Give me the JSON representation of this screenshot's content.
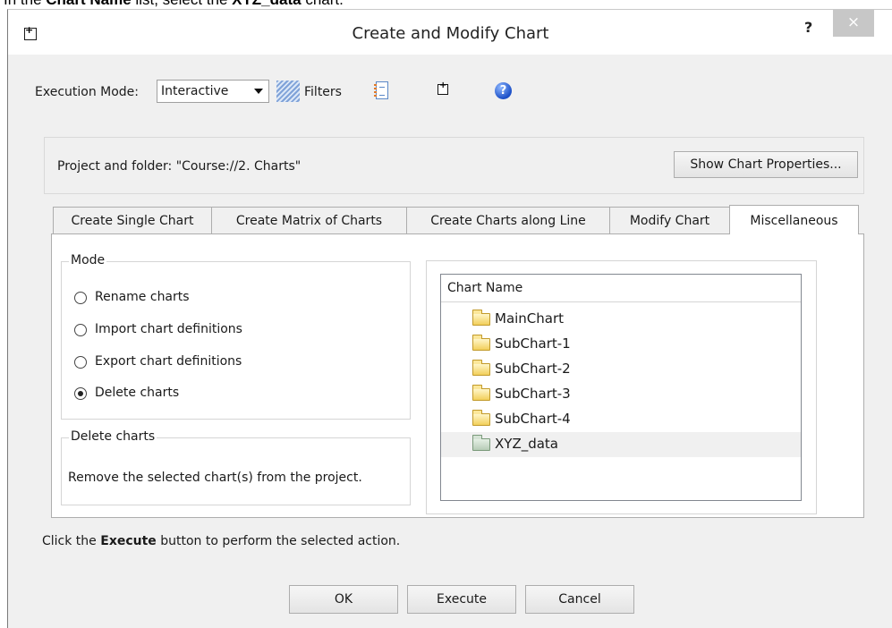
{
  "instruction": {
    "prefix": "In the ",
    "list_name": "Chart Name",
    "middle": " list, select the ",
    "item_name": "XYZ_data",
    "suffix": " chart."
  },
  "dialog": {
    "title": "Create and Modify Chart",
    "help_label": "?",
    "close_label": "×"
  },
  "toolbar": {
    "execution_mode_label": "Execution Mode:",
    "execution_mode_value": "Interactive",
    "filters_label": "Filters",
    "help_glyph": "?"
  },
  "project": {
    "label": "Project and folder: \"Course://2. Charts\"",
    "show_properties_button": "Show Chart Properties..."
  },
  "tabs": [
    {
      "label": "Create Single Chart",
      "active": false
    },
    {
      "label": "Create Matrix of Charts",
      "active": false
    },
    {
      "label": "Create Charts along Line",
      "active": false
    },
    {
      "label": "Modify Chart",
      "active": false
    },
    {
      "label": "Miscellaneous",
      "active": true
    }
  ],
  "mode": {
    "title": "Mode",
    "options": [
      {
        "label": "Rename charts",
        "checked": false
      },
      {
        "label": "Import chart definitions",
        "checked": false
      },
      {
        "label": "Export chart definitions",
        "checked": false
      },
      {
        "label": "Delete charts",
        "checked": true
      }
    ]
  },
  "description": {
    "title": "Delete charts",
    "text": "Remove the selected chart(s) from the project."
  },
  "chart_list": {
    "header": "Chart Name",
    "items": [
      {
        "label": "MainChart",
        "selected": false,
        "icon": "folder-icon"
      },
      {
        "label": "SubChart-1",
        "selected": false,
        "icon": "folder-icon"
      },
      {
        "label": "SubChart-2",
        "selected": false,
        "icon": "folder-icon"
      },
      {
        "label": "SubChart-3",
        "selected": false,
        "icon": "folder-icon"
      },
      {
        "label": "SubChart-4",
        "selected": false,
        "icon": "folder-icon"
      },
      {
        "label": "XYZ_data",
        "selected": true,
        "icon": "data-folder-icon"
      }
    ]
  },
  "hint": {
    "prefix": "Click the ",
    "bold": "Execute",
    "suffix": " button to perform the selected action."
  },
  "buttons": {
    "ok": "OK",
    "execute": "Execute",
    "cancel": "Cancel"
  }
}
